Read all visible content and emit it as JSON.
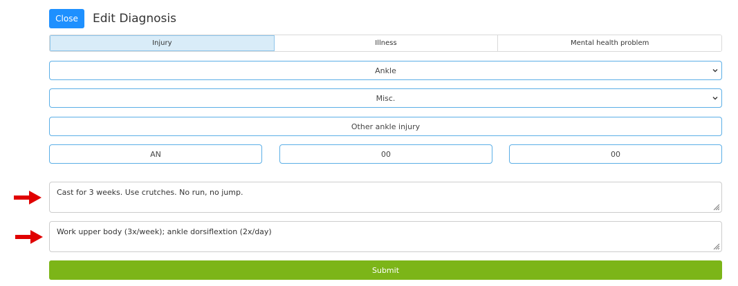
{
  "header": {
    "close_label": "Close",
    "title": "Edit Diagnosis"
  },
  "tabs": [
    {
      "label": "Injury",
      "active": true
    },
    {
      "label": "Illness",
      "active": false
    },
    {
      "label": "Mental health problem",
      "active": false
    }
  ],
  "form": {
    "body_part": "Ankle",
    "category": "Misc.",
    "diagnosis": "Other ankle injury",
    "codes": [
      "AN",
      "00",
      "00"
    ],
    "restrictions": "Cast for 3 weeks. Use crutches. No run, no jump.",
    "exercises": "Work upper body (3x/week); ankle dorsiflextion (2x/day)",
    "submit_label": "Submit"
  },
  "colors": {
    "close_button": "#1e90ff",
    "submit_button": "#7cb518",
    "field_border": "#5aaee6",
    "active_tab": "#d9ecf8",
    "arrow": "#e00000"
  }
}
